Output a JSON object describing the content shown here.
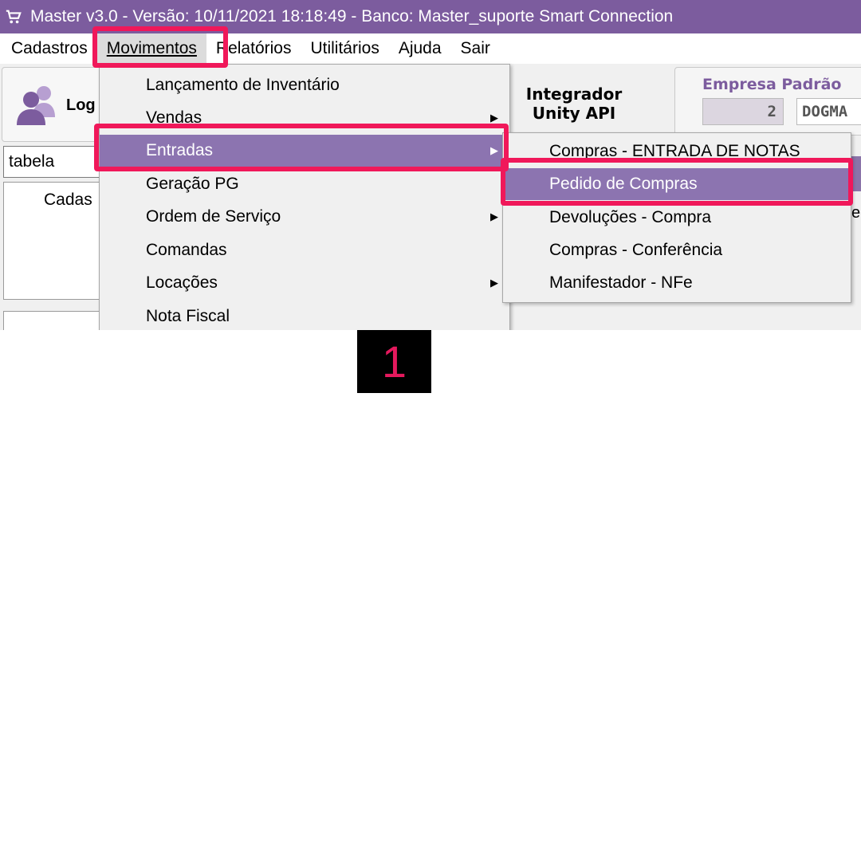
{
  "window": {
    "title": "Master  v3.0 -  Versão: 10/11/2021 18:18:49 - Banco: Master_suporte Smart Connection",
    "icon": "cart-icon"
  },
  "menubar": {
    "items": [
      "Cadastros",
      "Movimentos",
      "Relatórios",
      "Utilitários",
      "Ajuda",
      "Sair"
    ],
    "active": "Movimentos"
  },
  "toolbar": {
    "login_label": "Log",
    "login_icon": "users-icon"
  },
  "integrador": {
    "line1": "Integrador",
    "line2": "Unity API"
  },
  "empresa": {
    "title": "Empresa Padrão",
    "code": "2",
    "name": "DOGMA"
  },
  "search": {
    "value": "tabela"
  },
  "panel": {
    "label": "Cadas"
  },
  "right_fragment": "e",
  "dropdown": {
    "items": [
      {
        "label": "Lançamento de Inventário",
        "has_submenu": false
      },
      {
        "label": "Vendas",
        "has_submenu": true
      },
      {
        "label": "Entradas",
        "has_submenu": true,
        "highlighted": true
      },
      {
        "label": "Geração PG",
        "has_submenu": false
      },
      {
        "label": "Ordem de Serviço",
        "has_submenu": true
      },
      {
        "label": "Comandas",
        "has_submenu": false
      },
      {
        "label": "Locações",
        "has_submenu": true
      },
      {
        "label": "Nota Fiscal",
        "has_submenu": false
      }
    ]
  },
  "submenu": {
    "items": [
      {
        "label": "Compras - ENTRADA DE NOTAS"
      },
      {
        "label": "Pedido de Compras",
        "highlighted": true
      },
      {
        "label": "Devoluções - Compra"
      },
      {
        "label": "Compras - Conferência"
      },
      {
        "label": "Manifestador - NFe"
      }
    ]
  },
  "step_badge": "1",
  "colors": {
    "title_bar": "#7c5c9e",
    "highlight": "#8c74b0",
    "annotation": "#f0185a",
    "badge_bg": "#000000",
    "badge_text": "#e5195d"
  }
}
